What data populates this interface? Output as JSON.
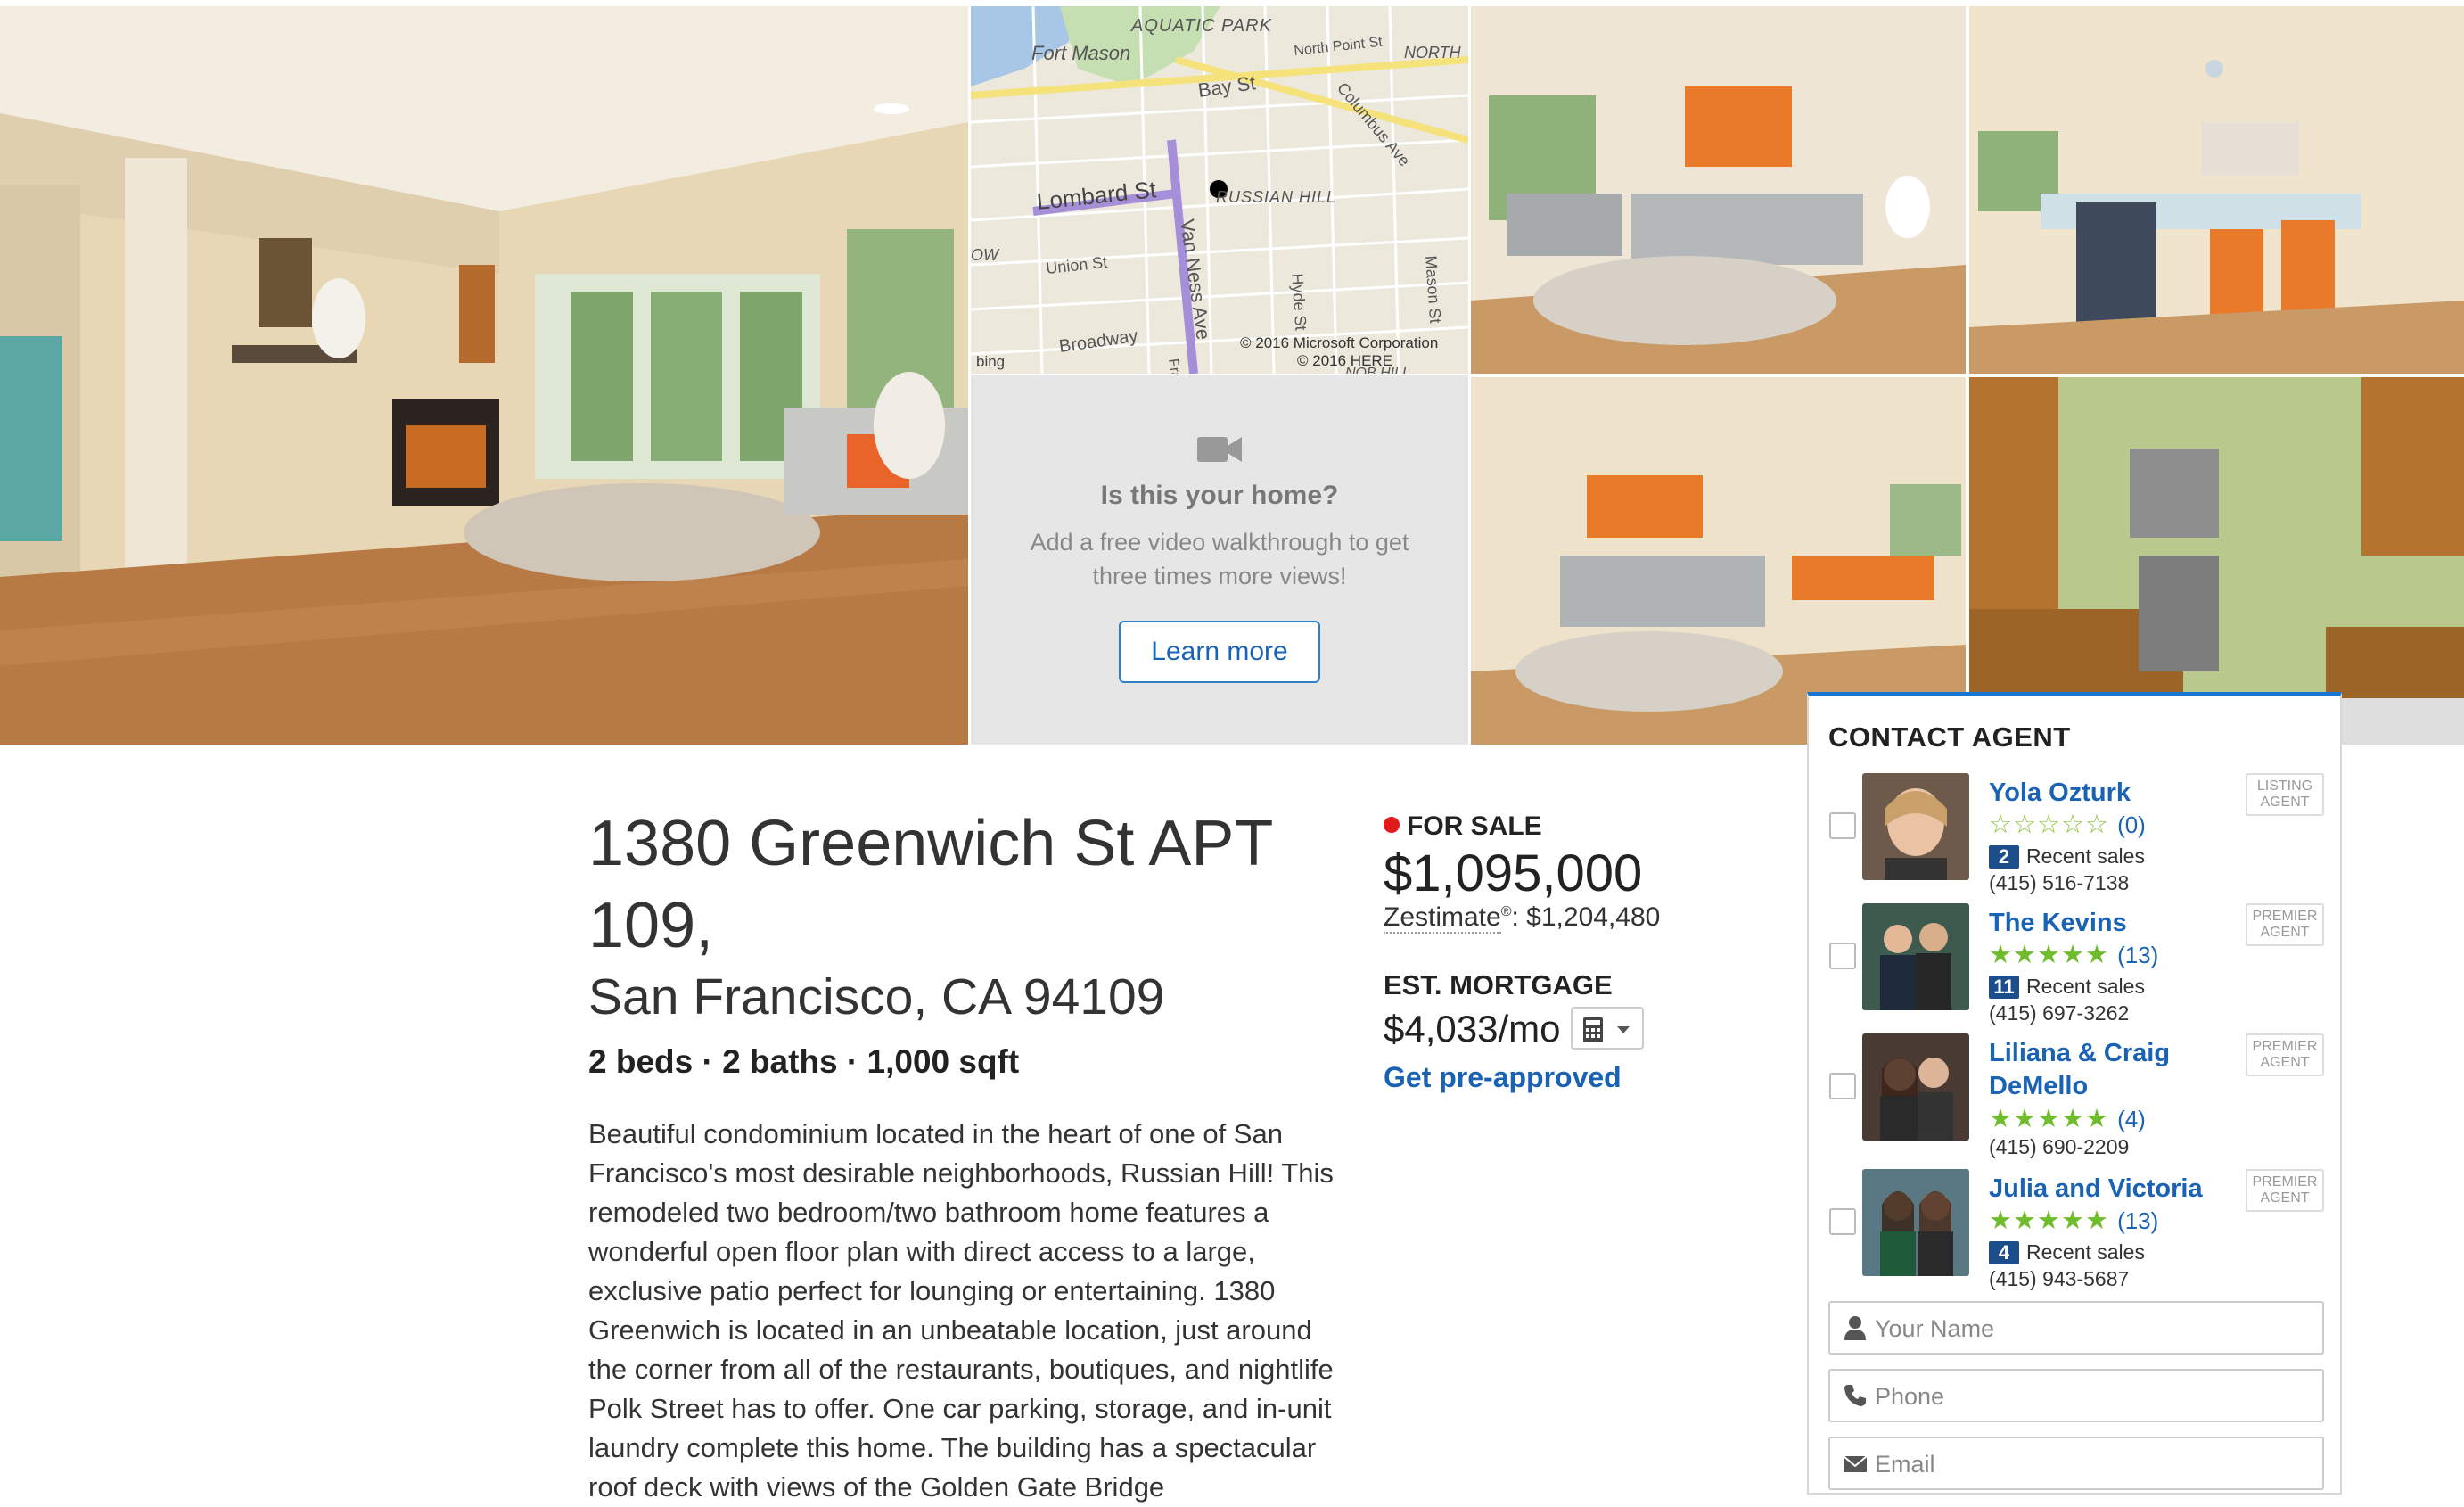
{
  "video_promo": {
    "title": "Is this your home?",
    "subtitle": "Add a free video walkthrough to get three times more views!",
    "button_label": "Learn more"
  },
  "map": {
    "labels": {
      "aquatic_park": "AQUATIC PARK",
      "fort_mason": "Fort Mason",
      "north_point": "North Point St",
      "north": "NORTH",
      "bay_st": "Bay St",
      "columbus": "Columbus Ave",
      "lombard": "Lombard St",
      "russian_hill": "RUSSIAN HILL",
      "union": "Union St",
      "van_ness": "Van Ness Ave",
      "hyde": "Hyde St",
      "mason": "Mason St",
      "broadway": "Broadway",
      "ow": "OW",
      "fra": "Fra",
      "nor_hill": "NOB HILL"
    },
    "attribution_bing": "bing",
    "copyright_ms": "© 2016 Microsoft Corporation",
    "copyright_here": "© 2016 HERE"
  },
  "listing": {
    "address_line1": "1380 Greenwich St APT 109,",
    "address_line2": "San Francisco, CA 94109",
    "facts": "2 beds · 2 baths · 1,000 sqft",
    "description": "Beautiful condominium located in the heart of one of San Francisco's most desirable neighborhoods, Russian Hill! This remodeled two bedroom/two bathroom home features a wonderful open floor plan with direct access to a large, exclusive patio perfect for lounging or entertaining. 1380 Greenwich is located in an unbeatable location, just around the corner from all of the restaurants, boutiques, and nightlife Polk Street has to offer. One car parking, storage, and in-unit laundry complete this home. The building has a spectacular roof deck with views of the Golden Gate Bridge",
    "status": "FOR SALE",
    "status_color": "#e01b1b",
    "price": "$1,095,000",
    "zestimate_label": "Zestimate",
    "zestimate_reg": "®",
    "zestimate_value": ": $1,204,480",
    "est_mortgage_label": "EST. MORTGAGE",
    "mortgage": "$4,033/mo",
    "preapproved": "Get pre-approved"
  },
  "contact": {
    "title": "CONTACT AGENT",
    "agents": [
      {
        "name": "Yola Ozturk",
        "stars": "☆☆☆☆☆",
        "reviews": "(0)",
        "sales_count": "2",
        "sales_label": "Recent sales",
        "phone": "(415) 516-7138",
        "badge": "LISTING AGENT"
      },
      {
        "name": "The Kevins",
        "stars": "★★★★★",
        "reviews": "(13)",
        "sales_count": "11",
        "sales_label": "Recent sales",
        "phone": "(415) 697-3262",
        "badge": "PREMIER AGENT"
      },
      {
        "name": "Liliana & Craig DeMello",
        "stars": "★★★★★",
        "reviews": "(4)",
        "phone": "(415) 690-2209",
        "badge": "PREMIER AGENT"
      },
      {
        "name": "Julia and Victoria",
        "stars": "★★★★★",
        "reviews": "(13)",
        "sales_count": "4",
        "sales_label": "Recent sales",
        "phone": "(415) 943-5687",
        "badge": "PREMIER AGENT"
      }
    ],
    "name_placeholder": "Your Name",
    "phone_placeholder": "Phone",
    "email_placeholder": "Email"
  },
  "colors": {
    "accent_blue": "#1a63b4",
    "panel_border_top": "#1877d2",
    "star_green": "#6fbd2c"
  }
}
